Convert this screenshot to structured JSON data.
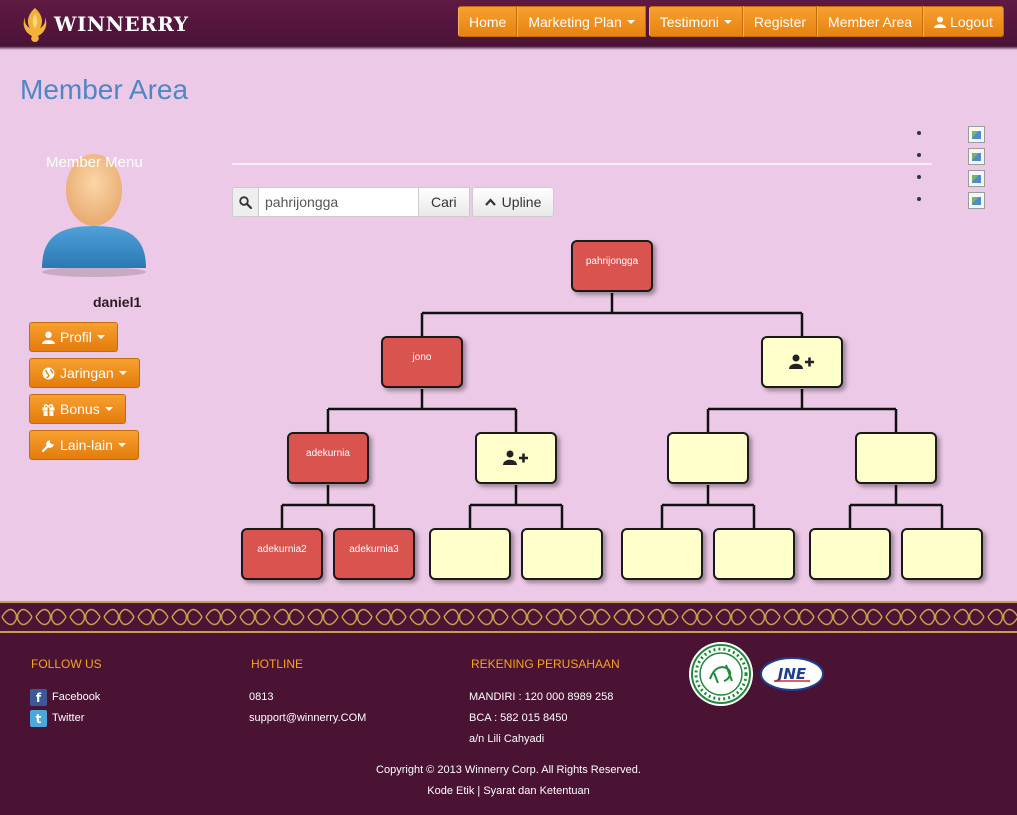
{
  "brand": {
    "name": "WINNERRY"
  },
  "nav": {
    "home": "Home",
    "marketing_plan": "Marketing Plan",
    "testimoni": "Testimoni",
    "register": "Register",
    "member_area": "Member Area",
    "logout": "Logout"
  },
  "page": {
    "title": "Member Area"
  },
  "sidebar": {
    "heading": "Member Menu",
    "username": "daniel1",
    "menu": [
      {
        "label": "Profil",
        "icon": "user-icon"
      },
      {
        "label": "Jaringan",
        "icon": "globe-icon"
      },
      {
        "label": "Bonus",
        "icon": "gift-icon"
      },
      {
        "label": "Lain-lain",
        "icon": "wrench-icon"
      }
    ]
  },
  "search": {
    "value": "pahrijongga",
    "button": "Cari",
    "upline_button": "Upline"
  },
  "tree": {
    "root": "pahrijongga",
    "level1": [
      "jono",
      ""
    ],
    "level2": [
      "adekurnia",
      "",
      "",
      ""
    ],
    "level3": [
      "adekurnia2",
      "adekurnia3",
      "",
      "",
      "",
      "",
      "",
      ""
    ]
  },
  "footer": {
    "follow_heading": "FOLLOW US",
    "facebook": "Facebook",
    "twitter": "Twitter",
    "hotline_heading": "HOTLINE",
    "phone": "0813",
    "email": "support@winnerry.COM",
    "bank_heading": "REKENING PERUSAHAAN",
    "mandiri": "MANDIRI : 120 000 8989 258",
    "bca": "BCA : 582 015 8450",
    "account_name": "a/n Lili Cahyadi",
    "copyright": "Copyright © 2013 Winnerry Corp. All Rights Reserved.",
    "kode_etik": "Kode Etik",
    "separator": " | ",
    "syarat": "Syarat dan Ketentuan"
  },
  "colors": {
    "background": "#ecc9e6",
    "header": "#5f1a44",
    "accent_orange": "#f7a031",
    "node_filled": "#d9534f",
    "node_empty": "#ffffcc",
    "footer": "#4a1233",
    "title_blue": "#4f86c6"
  }
}
